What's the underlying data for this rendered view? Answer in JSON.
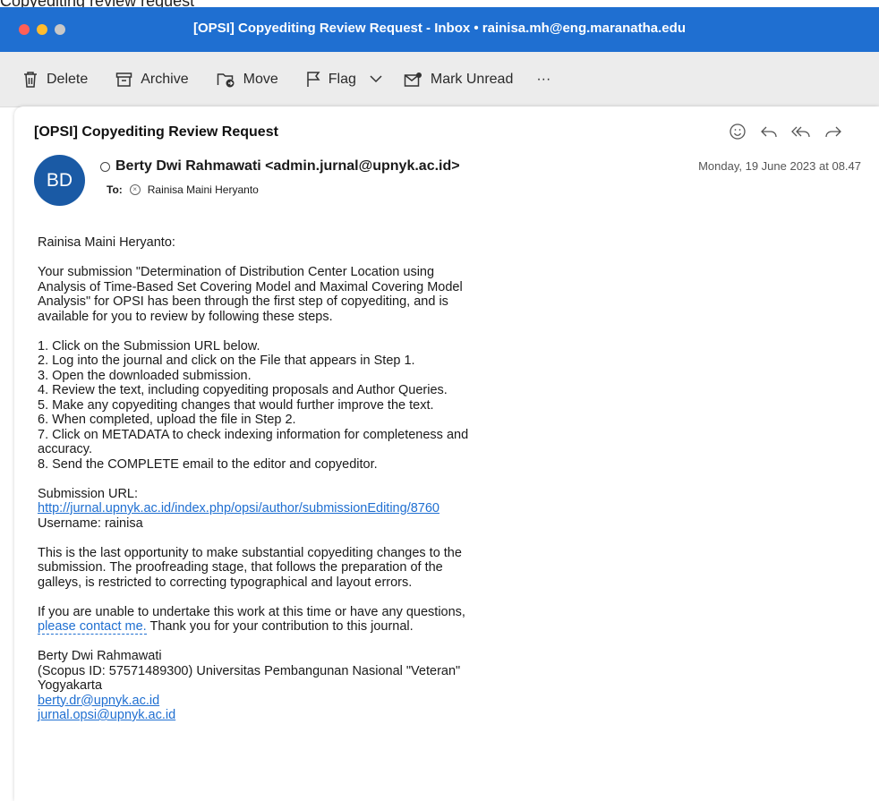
{
  "header_fragment": "Copyediting review request",
  "window": {
    "title": "[OPSI] Copyediting Review Request - Inbox • rainisa.mh@eng.maranatha.edu",
    "traffic_lights": [
      "#ff5f57",
      "#febc2e",
      "#c8c8c8"
    ]
  },
  "toolbar": {
    "delete": "Delete",
    "archive": "Archive",
    "move": "Move",
    "flag": "Flag",
    "mark_unread": "Mark Unread",
    "more": "···"
  },
  "message": {
    "subject": "[OPSI] Copyediting Review Request",
    "avatar_initials": "BD",
    "sender": "Berty Dwi Rahmawati <admin.jurnal@upnyk.ac.id>",
    "to_label": "To:",
    "recipient": "Rainisa Maini Heryanto",
    "date": "Monday, 19 June 2023 at 08.47",
    "icons": [
      "smiley-icon",
      "reply-icon",
      "reply-all-icon",
      "forward-icon"
    ]
  },
  "body": {
    "greeting": "Rainisa Maini Heryanto:",
    "intro": [
      "Your submission \"Determination of Distribution Center Location using",
      "Analysis of Time-Based Set Covering Model and Maximal Covering Model",
      "Analysis\" for OPSI has been through the first step of copyediting, and is",
      "available for you to review by following these steps."
    ],
    "steps": [
      "1. Click on the Submission URL below.",
      "2. Log into the journal and click on the File that appears in Step 1.",
      "3. Open the downloaded submission.",
      "4. Review the text, including copyediting proposals and Author Queries.",
      "5. Make any copyediting changes that would further improve the text.",
      "6. When completed, upload the file in Step 2.",
      "7. Click on METADATA to check indexing information for completeness and",
      "accuracy.",
      "8. Send the COMPLETE email to the editor and copyeditor."
    ],
    "submission_url_label": "Submission URL:",
    "submission_url": "http://jurnal.upnyk.ac.id/index.php/opsi/author/submissionEditing/8760",
    "username": "Username: rainisa",
    "last_opportunity": [
      "This is the last opportunity to make substantial copyediting changes to the",
      "submission. The proofreading stage, that follows the preparation of the",
      "galleys, is restricted to correcting typographical and layout errors."
    ],
    "unable_line1": "If you are unable to undertake this work at this time or have any questions,",
    "contact_link": "please contact me.",
    "thanks": " Thank you for your contribution to this journal.",
    "signature": {
      "name": "Berty Dwi Rahmawati",
      "line2": "(Scopus ID: 57571489300) Universitas Pembangunan Nasional \"Veteran\"",
      "line3": "Yogyakarta",
      "email1": "berty.dr@upnyk.ac.id",
      "email2": "jurnal.opsi@upnyk.ac.id"
    }
  }
}
